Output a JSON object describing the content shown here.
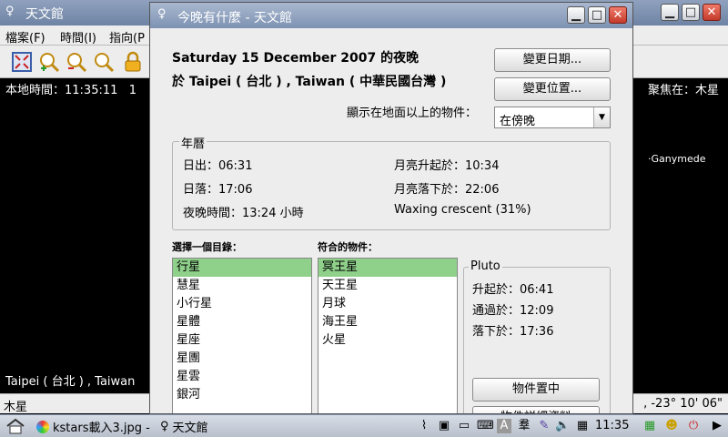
{
  "bg_window": {
    "title": "天文館",
    "menu": [
      "檔案(F)",
      "時間(I)",
      "指向(P"
    ],
    "local_time": "本地時間：11:35:11",
    "local_time_tail": "1",
    "focus": "聚焦在：木星",
    "sky_label": "·Ganymede",
    "location": "Taipei ( 台北 ) , Taiwan",
    "status_left": "木星",
    "status_right": ", -23° 10' 06\""
  },
  "dialog": {
    "title": "今晚有什麼 - 天文館",
    "heading_line1": "Saturday 15 December 2007 的夜晚",
    "heading_line2": "於 Taipei ( 台北 ) , Taiwan ( 中華民國台灣 )",
    "change_date_button": "變更日期...",
    "change_location_button": "變更位置...",
    "show_objects_label": "顯示在地面以上的物件：",
    "show_objects_value": "在傍晚",
    "almanac": {
      "title": "年曆",
      "sunrise": "日出：06:31",
      "sunset": "日落：17:06",
      "night_duration": "夜晚時間：13:24 小時",
      "moonrise": "月亮升起於：10:34",
      "moonset": "月亮落下於：22:06",
      "moon_phase": "Waxing crescent (31%)"
    },
    "catalog_header": "選擇一個目錄：",
    "catalogs": [
      "行星",
      "慧星",
      "小行星",
      "星體",
      "星座",
      "星團",
      "星雲",
      "銀河"
    ],
    "matching_header": "符合的物件：",
    "matching": [
      "冥王星",
      "天王星",
      "月球",
      "海王星",
      "火星"
    ],
    "details": {
      "title": "Pluto",
      "rises": "升起於：06:41",
      "transits": "通過於：12:09",
      "sets": "落下於：17:36",
      "center_button": "物件置中",
      "details_button": "物件詳細資料"
    }
  },
  "taskbar": {
    "task1": "kstars載入3.jpg -",
    "task2": "天文館",
    "clock": "11:35"
  },
  "colors": {
    "selection": "#8fd08a",
    "title_bar": "#7d92b3",
    "close_button": "#c43a2a"
  }
}
